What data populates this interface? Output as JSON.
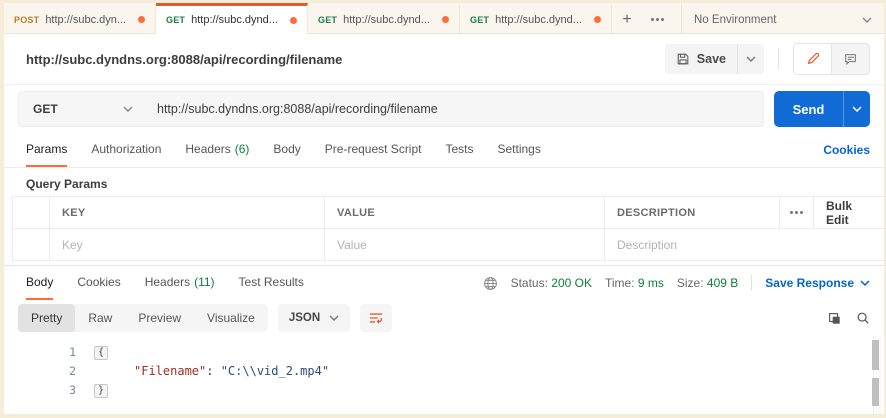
{
  "colors": {
    "accent_orange": "#ff6c37",
    "tab_active_border": "#e05c2e",
    "link_blue": "#0265d2",
    "send_blue": "#106bd5",
    "success_green": "#0e7e3c",
    "post_method_color": "#b97d26",
    "get_method_color": "#1a7f45"
  },
  "icons": {
    "plus": "+",
    "more": "ooo",
    "save": "floppy-disk",
    "edit": "pencil",
    "comment": "speech-bubble",
    "globe": "globe",
    "wrap": "wrap-lines",
    "copy": "overlapping-squares",
    "search": "magnifier"
  },
  "tabbar": {
    "tabs": [
      {
        "method": "POST",
        "url": "http://subc.dyn..."
      },
      {
        "method": "GET",
        "url": "http://subc.dynd..."
      },
      {
        "method": "GET",
        "url": "http://subc.dynd..."
      },
      {
        "method": "GET",
        "url": "http://subc.dynd..."
      }
    ],
    "environment": "No Environment"
  },
  "request": {
    "title": "http://subc.dyndns.org:8088/api/recording/filename",
    "save_label": "Save",
    "method": "GET",
    "url": "http://subc.dyndns.org:8088/api/recording/filename",
    "send_label": "Send",
    "tabs": [
      {
        "label": "Params"
      },
      {
        "label": "Authorization"
      },
      {
        "label": "Headers",
        "count": "(6)"
      },
      {
        "label": "Body"
      },
      {
        "label": "Pre-request Script"
      },
      {
        "label": "Tests"
      },
      {
        "label": "Settings"
      }
    ],
    "cookies_link": "Cookies",
    "query_params": {
      "title": "Query Params",
      "columns": {
        "key": "KEY",
        "value": "VALUE",
        "description": "DESCRIPTION"
      },
      "bulk_edit_label": "Bulk Edit",
      "placeholders": {
        "key": "Key",
        "value": "Value",
        "description": "Description"
      }
    }
  },
  "response": {
    "tabs": [
      {
        "label": "Body"
      },
      {
        "label": "Cookies"
      },
      {
        "label": "Headers",
        "count": "(11)"
      },
      {
        "label": "Test Results"
      }
    ],
    "meta": {
      "status_label": "Status:",
      "status_value": "200 OK",
      "time_label": "Time:",
      "time_value": "9 ms",
      "size_label": "Size:",
      "size_value": "409 B"
    },
    "save_response_label": "Save Response",
    "view_tabs": {
      "pretty": "Pretty",
      "raw": "Raw",
      "preview": "Preview",
      "visualize": "Visualize"
    },
    "format_label": "JSON",
    "code": {
      "lines": [
        {
          "num": "1",
          "open_brace": "{"
        },
        {
          "num": "2",
          "key": "\"Filename\"",
          "sep": ": ",
          "value": "\"C:\\\\vid_2.mp4\""
        },
        {
          "num": "3",
          "close_brace": "}"
        }
      ]
    }
  }
}
